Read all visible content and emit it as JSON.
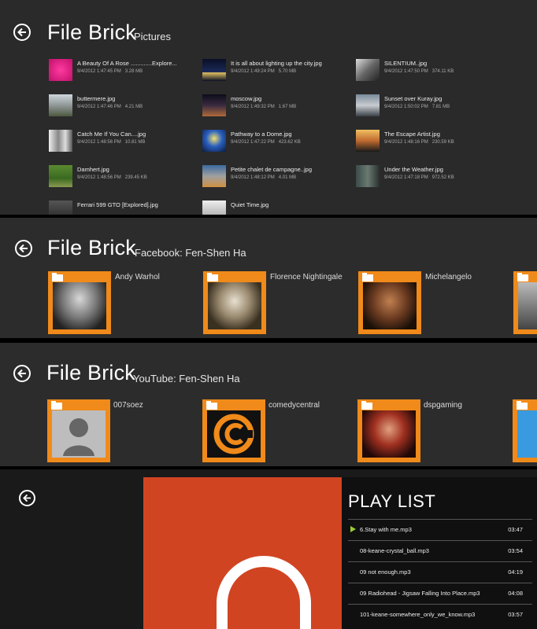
{
  "panel1": {
    "title": "File Brick",
    "subtitle": "Pictures",
    "files": [
      {
        "name": "A Beauty Of A Rose .............Explore...",
        "date": "9/4/2012 1:47:45 PM",
        "size": "3.28 MB"
      },
      {
        "name": "It is all about lighting up the city.jpg",
        "date": "9/4/2012 1:49:24 PM",
        "size": "5.70 MB"
      },
      {
        "name": "SILENTIUM..jpg",
        "date": "9/4/2012 1:47:50 PM",
        "size": "374.11 KB"
      },
      {
        "name": "buttermere.jpg",
        "date": "9/4/2012 1:47:46 PM",
        "size": "4.21 MB"
      },
      {
        "name": "moscow.jpg",
        "date": "9/4/2012 1:49:32 PM",
        "size": "1.67 MB"
      },
      {
        "name": "Sunset over Kuray.jpg",
        "date": "9/4/2012 1:50:02 PM",
        "size": "7.81 MB"
      },
      {
        "name": "Catch Me If You Can....jpg",
        "date": "9/4/2012 1:48:56 PM",
        "size": "10.81 MB"
      },
      {
        "name": "Pathway to a Dome.jpg",
        "date": "9/4/2012 1:47:22 PM",
        "size": "423.62 KB"
      },
      {
        "name": "The Escape Artist.jpg",
        "date": "9/4/2012 1:48:16 PM",
        "size": "230.59 KB"
      },
      {
        "name": "Damhert.jpg",
        "date": "9/4/2012 1:48:56 PM",
        "size": "239.45 KB"
      },
      {
        "name": "Petite chalet de campagne..jpg",
        "date": "9/4/2012 1:48:12 PM",
        "size": "4.01 MB"
      },
      {
        "name": "Under the Weather.jpg",
        "date": "9/4/2012 1:47:18 PM",
        "size": "972.52 KB"
      },
      {
        "name": "Ferrari 599 GTO [Explored].jpg",
        "date": "",
        "size": ""
      },
      {
        "name": "Quiet Time.jpg",
        "date": "",
        "size": ""
      }
    ]
  },
  "panel2": {
    "title": "File Brick",
    "subtitle": "Facebook: Fen-Shen Ha",
    "items": [
      {
        "name": "Andy Warhol"
      },
      {
        "name": "Florence Nightingale"
      },
      {
        "name": "Michelangelo"
      }
    ]
  },
  "panel3": {
    "title": "File Brick",
    "subtitle": "YouTube: Fen-Shen Ha",
    "items": [
      {
        "name": "007soez"
      },
      {
        "name": "comedycentral"
      },
      {
        "name": "dspgaming"
      }
    ]
  },
  "player": {
    "playlist_title": "PLAY LIST",
    "tracks": [
      {
        "title": "6.Stay with me.mp3",
        "duration": "03:47",
        "playing": true
      },
      {
        "title": "08-keane-crystal_ball.mp3",
        "duration": "03:54"
      },
      {
        "title": "09 not enough.mp3",
        "duration": "04:19"
      },
      {
        "title": "09 Radiohead - Jigsaw Falling Into Place.mp3",
        "duration": "04:08"
      },
      {
        "title": "101-keane-somewhere_only_we_know.mp3",
        "duration": "03:57"
      }
    ]
  },
  "colors": {
    "accent_orange": "#f08a1a",
    "album_red": "#d14422",
    "playing_green": "#9acd32"
  }
}
